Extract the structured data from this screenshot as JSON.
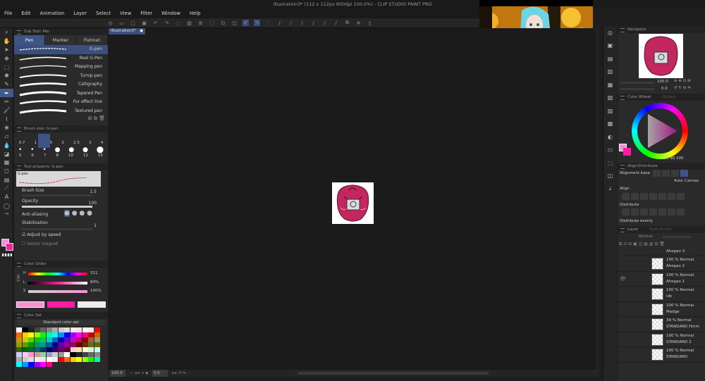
{
  "window": {
    "title": "Illustration3* (112 x 112px 600dpi 100.0%) - CLIP STUDIO PAINT PRO"
  },
  "menu": [
    "File",
    "Edit",
    "Animation",
    "Layer",
    "Select",
    "View",
    "Filter",
    "Window",
    "Help"
  ],
  "subtool": {
    "panel_title": "Sub Tool: Pen",
    "tabs": [
      "Pen",
      "Marker",
      "Fishnet"
    ],
    "brushes": [
      "G-pen",
      "Real G-Pen",
      "Mapping pen",
      "Turnip pen",
      "Calligraphy",
      "Tapered Pen",
      "For effect line",
      "Textured pen"
    ]
  },
  "brush_size": {
    "title": "Brush size: G-pen",
    "row1": [
      "0.7",
      "1",
      "1.5",
      "2",
      "2.5",
      "3",
      "4"
    ],
    "row2": [
      "5",
      "6",
      "7",
      "8",
      "10",
      "12",
      "15"
    ]
  },
  "tool_property": {
    "title": "Tool property: G-pen",
    "preview_label": "G-pen",
    "brush_size_label": "Brush Size",
    "brush_size_value": "1.5",
    "opacity_label": "Opacity",
    "opacity_value": "100",
    "antialias_label": "Anti-aliasing",
    "stabilization_label": "Stabilization",
    "stabilization_value": "1",
    "adjust_speed_label": "Adjust by speed",
    "vector_magnet_label": "Vector magnet"
  },
  "color_slider": {
    "title": "Color Slider",
    "mode": "HLS",
    "h_label": "H",
    "h": "311",
    "l_label": "L",
    "l": "80%",
    "s_label": "S",
    "s": "100%"
  },
  "color_set": {
    "title": "Color Set",
    "selected": "Standard color set"
  },
  "canvas": {
    "tab": "Illustration3*",
    "zoom": "100.0",
    "angle": "0.0"
  },
  "navigator": {
    "title": "Navigator",
    "zoom": "100.0",
    "angle": "0.0"
  },
  "color_wheel": {
    "title": "Color Wheel",
    "inactive_tab": "History",
    "readout_h": "311",
    "readout_s": "80",
    "readout_v": "100"
  },
  "align": {
    "title": "Align/Distribute",
    "base_label": "Alignment base",
    "auto": "Auto",
    "canvas": "Canvas",
    "align_label": "Align",
    "distribute_label": "Distribute",
    "distribute_evenly_label": "Distribute evenly"
  },
  "layer": {
    "title": "Layer",
    "inactive_tab": "Auto Action",
    "blend": "Normal",
    "rows": [
      {
        "pct": "",
        "name": "Ahegao 3"
      },
      {
        "pct": "100 % Normal",
        "name": "Ahegao 2"
      },
      {
        "pct": "100 % Normal",
        "name": "Ahegao 1"
      },
      {
        "pct": "100 % Normal",
        "name": "idk"
      },
      {
        "pct": "100 % Normal",
        "name": "Madge"
      },
      {
        "pct": "39 % Normal",
        "name": "STANDARD Hmm"
      },
      {
        "pct": "100 % Normal",
        "name": "STANDARD 2"
      },
      {
        "pct": "100 % Normal",
        "name": "STANDARD"
      }
    ]
  },
  "colors": {
    "main": "#f590d5",
    "sub": "#ff1d9f",
    "accent": "#3d5585",
    "artwork_bg": "#c2285f"
  }
}
